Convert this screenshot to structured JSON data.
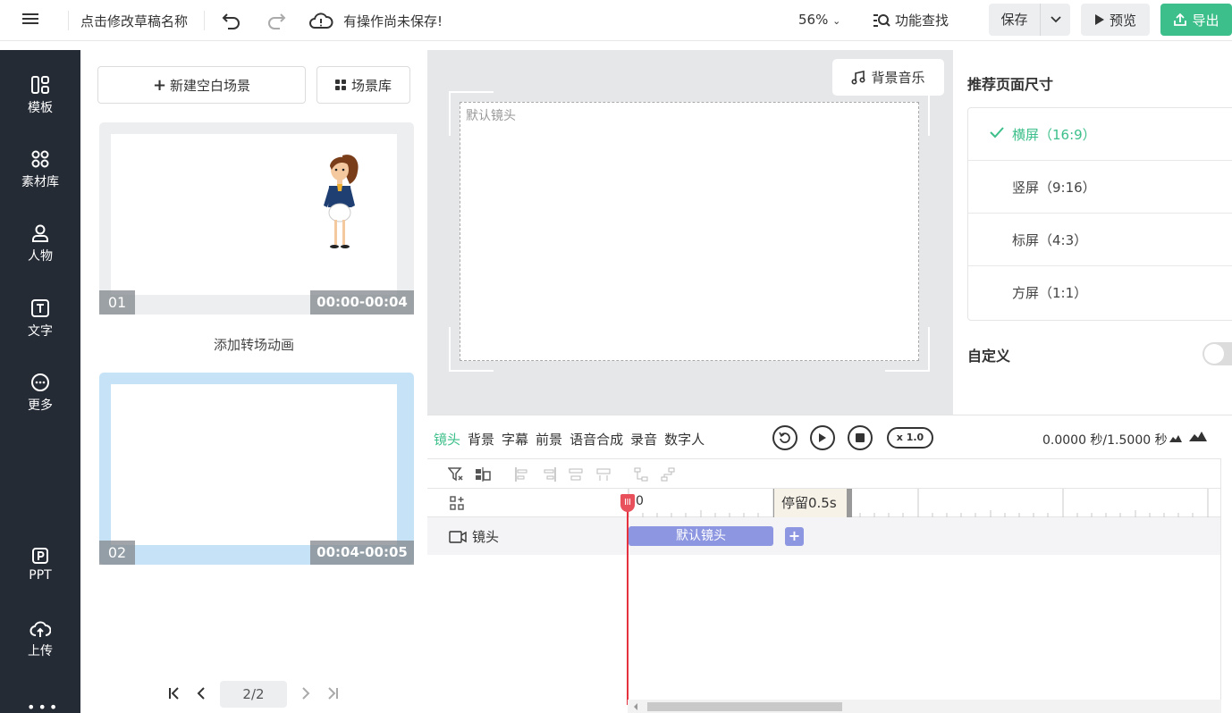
{
  "topbar": {
    "title": "点击修改草稿名称",
    "unsaved": "有操作尚未保存!",
    "zoom": "56%",
    "find": "功能查找",
    "save": "保存",
    "preview": "预览",
    "export": "导出"
  },
  "nav": {
    "items": [
      "模板",
      "素材库",
      "人物",
      "文字",
      "更多",
      "PPT",
      "上传"
    ],
    "more_dots": "•••"
  },
  "scenes": {
    "new_blank": "新建空白场景",
    "library": "场景库",
    "cards": [
      {
        "num": "01",
        "time": "00:00-00:04"
      },
      {
        "num": "02",
        "time": "00:04-00:05"
      }
    ],
    "transition": "添加转场动画",
    "page": "2/2"
  },
  "canvas": {
    "bgm": "背景音乐",
    "default_shot": "默认镜头"
  },
  "right": {
    "header": "推荐页面尺寸",
    "options": [
      "横屏（16:9）",
      "竖屏（9:16）",
      "标屏（4:3）",
      "方屏（1:1）"
    ],
    "selected_index": 0,
    "custom": "自定义",
    "custom_enabled": false
  },
  "timeline": {
    "tabs": [
      "镜头",
      "背景",
      "字幕",
      "前景",
      "语音合成",
      "录音",
      "数字人"
    ],
    "active_tab": 0,
    "speed": "x 1.0",
    "time": "0.0000 秒/1.5000 秒",
    "ruler_zero": "0",
    "stay": "停留0.5s",
    "track_label": "镜头",
    "clip_label": "默认镜头",
    "add": "+"
  },
  "colors": {
    "accent": "#3cbf8a",
    "nav_bg": "#252b35",
    "clip": "#8d96e0",
    "playhead": "#e5323e",
    "selected_card": "#c6e2f7",
    "card": "#eceef0"
  }
}
